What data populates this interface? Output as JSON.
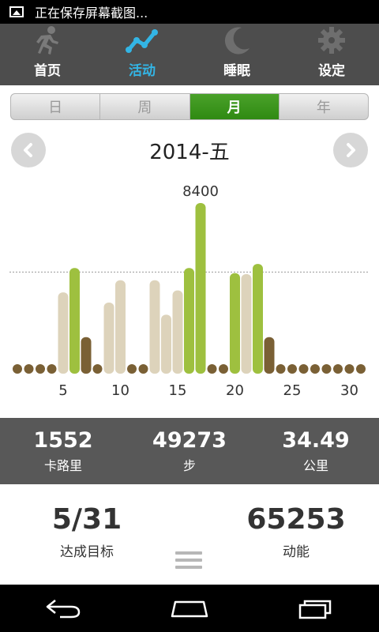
{
  "status": {
    "text": "正在保存屏幕截图..."
  },
  "nav": [
    {
      "label": "首页",
      "icon": "runner-icon",
      "active": false
    },
    {
      "label": "活动",
      "icon": "activity-graph-icon",
      "active": true
    },
    {
      "label": "睡眠",
      "icon": "moon-icon",
      "active": false
    },
    {
      "label": "设定",
      "icon": "gear-icon",
      "active": false
    }
  ],
  "segments": [
    {
      "label": "日",
      "active": false
    },
    {
      "label": "周",
      "active": false
    },
    {
      "label": "月",
      "active": true
    },
    {
      "label": "年",
      "active": false
    }
  ],
  "month": {
    "title": "2014-五",
    "prev_icon": "chevron-left-icon",
    "next_icon": "chevron-right-icon"
  },
  "chart_data": {
    "type": "bar",
    "x": [
      1,
      2,
      3,
      4,
      5,
      6,
      7,
      8,
      9,
      10,
      11,
      12,
      13,
      14,
      15,
      16,
      17,
      18,
      19,
      20,
      21,
      22,
      23,
      24,
      25,
      26,
      27,
      28,
      29,
      30,
      31
    ],
    "values": [
      0,
      0,
      0,
      0,
      4000,
      5200,
      1800,
      0,
      3500,
      4600,
      0,
      0,
      4600,
      2900,
      4100,
      5200,
      8400,
      0,
      0,
      4950,
      4900,
      5400,
      1800,
      0,
      0,
      0,
      0,
      0,
      0,
      0,
      0
    ],
    "kinds": [
      "none",
      "none",
      "none",
      "none",
      "beige",
      "green",
      "brown",
      "none",
      "beige",
      "beige",
      "none",
      "none",
      "beige",
      "beige",
      "beige",
      "green",
      "green",
      "none",
      "none",
      "green",
      "beige",
      "green",
      "brown",
      "none",
      "none",
      "none",
      "none",
      "none",
      "none",
      "none",
      "none"
    ],
    "peak_label": "8400",
    "ticks": [
      5,
      10,
      15,
      20,
      25,
      30
    ],
    "goal": 5000,
    "ylim": [
      0,
      8400
    ],
    "colors": {
      "green": "#9ec03f",
      "beige": "#ddd3bb",
      "brown": "#7a6035",
      "goal_line": "#9a9a9a"
    }
  },
  "stats": [
    {
      "value": "1552",
      "label": "卡路里"
    },
    {
      "value": "49273",
      "label": "步"
    },
    {
      "value": "34.49",
      "label": "公里"
    }
  ],
  "summary": {
    "goal": {
      "value": "5/31",
      "label": "达成目标"
    },
    "energy": {
      "value": "65253",
      "label": "动能"
    }
  },
  "system_nav": {
    "back": "back-icon",
    "home": "home-icon",
    "recents": "recents-icon"
  }
}
